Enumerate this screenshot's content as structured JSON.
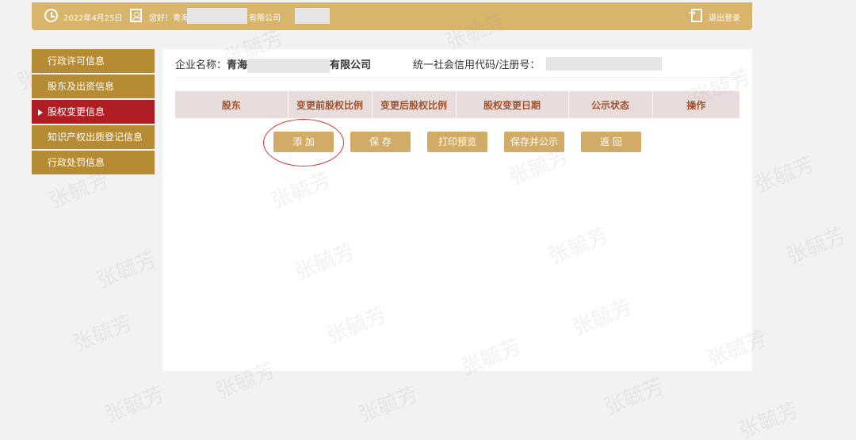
{
  "topbar": {
    "date": "2022年4月25日",
    "greeting": "您好！青海",
    "company_suffix": "有限公司",
    "logout": "退出登录"
  },
  "sidebar": {
    "items": [
      {
        "label": "行政许可信息"
      },
      {
        "label": "股东及出资信息"
      },
      {
        "label": "股权变更信息",
        "active": true
      },
      {
        "label": "知识产权出质登记信息"
      },
      {
        "label": "行政处罚信息"
      }
    ]
  },
  "main": {
    "company_label": "企业名称：",
    "company_prefix": "青海",
    "company_suffix": "有限公司",
    "credit_label": "统一社会信用代码/注册号："
  },
  "table": {
    "headers": [
      "股东",
      "变更前股权比例",
      "变更后股权比例",
      "股权变更日期",
      "公示状态",
      "操作"
    ]
  },
  "buttons": {
    "add": "添 加",
    "save": "保 存",
    "print": "打印预览",
    "save_publish": "保存并公示",
    "back": "返 回"
  },
  "watermark": "张毓芳",
  "colors": {
    "topbar": "#d9b46b",
    "sidebar": "#b58b34",
    "active": "#b01d23",
    "button": "#d2ab66"
  }
}
